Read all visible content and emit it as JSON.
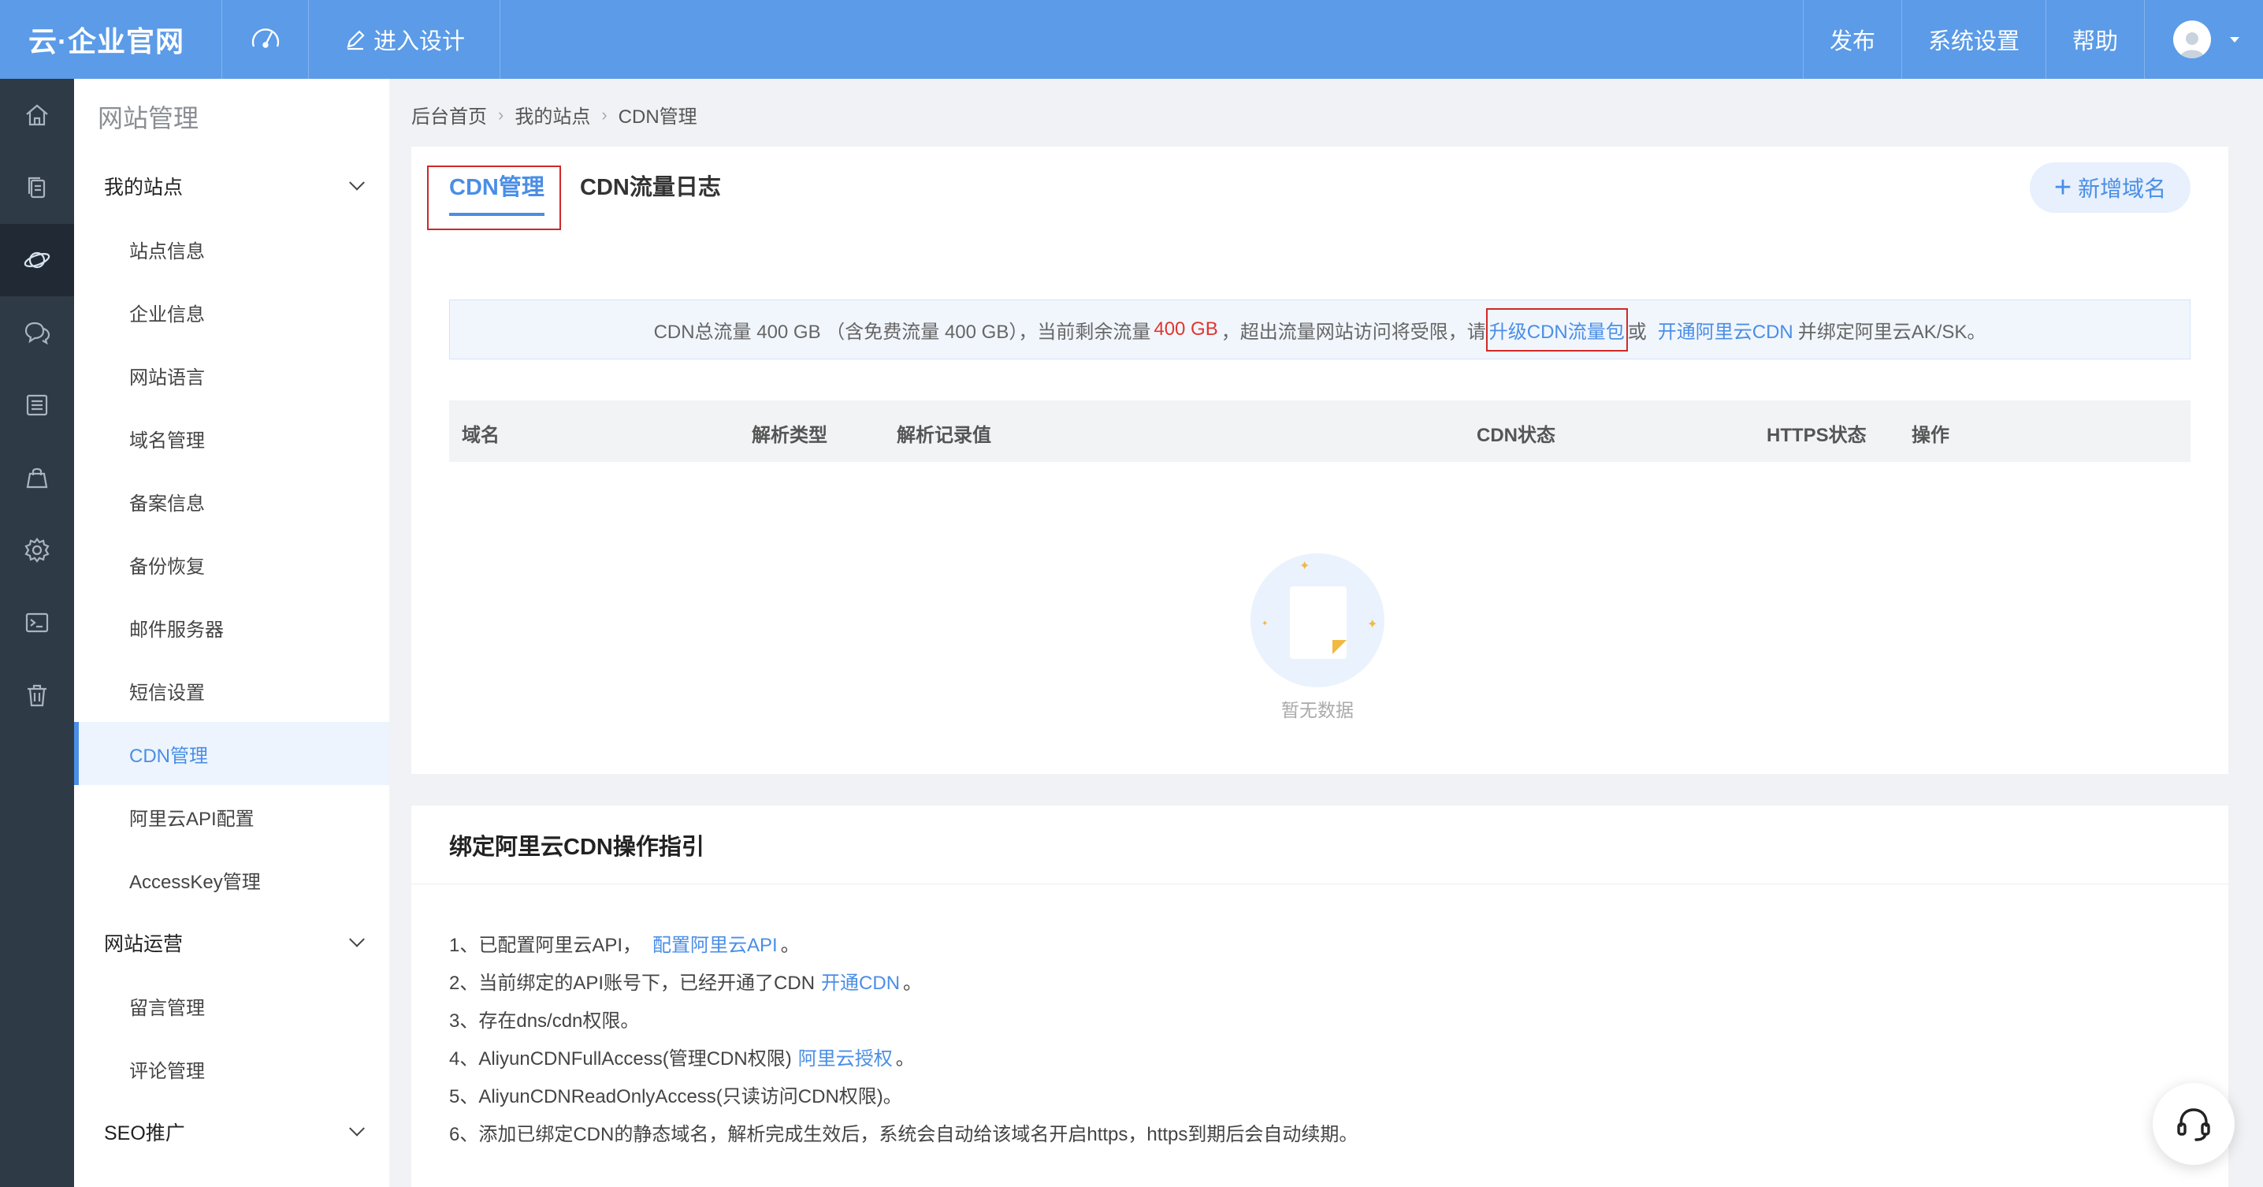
{
  "topbar": {
    "brand": "云·企业官网",
    "design_label": "进入设计",
    "publish": "发布",
    "settings": "系统设置",
    "help": "帮助"
  },
  "rail": {
    "icons": [
      "home-icon",
      "pages-icon",
      "planet-icon",
      "chat-icon",
      "list-icon",
      "bag-icon",
      "gear-icon",
      "terminal-icon",
      "trash-icon"
    ]
  },
  "sidemenu": {
    "title": "网站管理",
    "group1": "我的站点",
    "items": [
      "站点信息",
      "企业信息",
      "网站语言",
      "域名管理",
      "备案信息",
      "备份恢复",
      "邮件服务器",
      "短信设置",
      "CDN管理",
      "阿里云API配置",
      "AccessKey管理"
    ],
    "group2": "网站运营",
    "items2": [
      "留言管理",
      "评论管理"
    ],
    "group3": "SEO推广"
  },
  "breadcrumb": [
    "后台首页",
    "我的站点",
    "CDN管理"
  ],
  "tabs": {
    "active": "CDN管理",
    "second": "CDN流量日志",
    "add_button": "新增域名"
  },
  "notice": {
    "text1": "CDN总流量 400 GB （含免费流量 400 GB），当前剩余流量",
    "remaining": "400 GB",
    "text2": "，超出流量网站访问将受限，请",
    "link1": "升级CDN流量包",
    "text3": "或",
    "link2": "开通阿里云CDN",
    "text4": "并绑定阿里云AK/SK。"
  },
  "table": {
    "headers": [
      "域名",
      "解析类型",
      "解析记录值",
      "CDN状态",
      "HTTPS状态",
      "操作"
    ],
    "empty_text": "暂无数据"
  },
  "guide": {
    "title": "绑定阿里云CDN操作指引",
    "line1": "1、已配置阿里云API，",
    "line1_link": "配置阿里云API",
    "line1_end": "。",
    "line2": "2、当前绑定的API账号下，已经开通了CDN",
    "line2_link": "开通CDN",
    "line2_end": "。",
    "line3": "3、存在dns/cdn权限。",
    "line4": "4、AliyunCDNFullAccess(管理CDN权限)",
    "line4_link": "阿里云授权",
    "line4_end": "。",
    "line5": "5、AliyunCDNReadOnlyAccess(只读访问CDN权限)。",
    "line6": "6、添加已绑定CDN的静态域名，解析完成生效后，系统会自动给该域名开启https，https到期后会自动续期。"
  },
  "colors": {
    "topbar": "#5b9be8",
    "accent": "#4a8ee6",
    "rail": "#2f3a47",
    "highlight_box": "#d02828"
  }
}
